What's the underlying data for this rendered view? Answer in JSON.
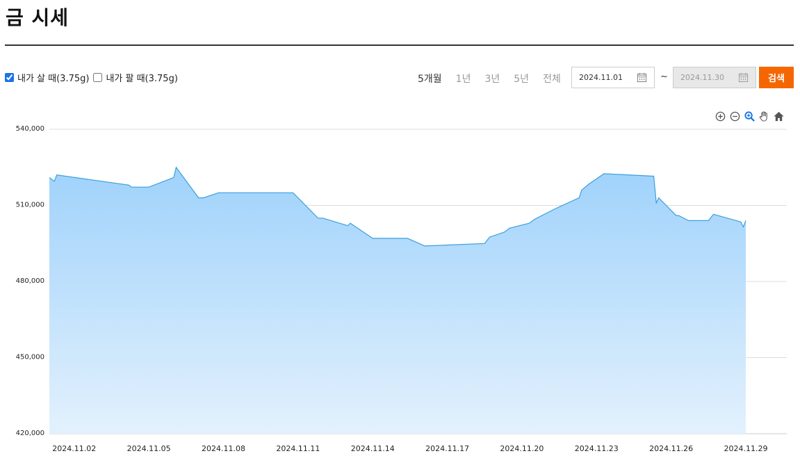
{
  "page": {
    "title": "금 시세"
  },
  "filters": {
    "buy_label": "내가 살 때(3.75g)",
    "buy_checked": true,
    "sell_label": "내가 팔 때(3.75g)",
    "sell_checked": false
  },
  "range_tabs": [
    {
      "label": "5개월",
      "active": true
    },
    {
      "label": "1년",
      "active": false
    },
    {
      "label": "3년",
      "active": false
    },
    {
      "label": "5년",
      "active": false
    },
    {
      "label": "전체",
      "active": false
    }
  ],
  "date_range": {
    "from": "2024.11.01",
    "separator": "~",
    "to": "2024.11.30"
  },
  "search_button_label": "검색",
  "toolbar_icons": [
    "zoom-in-icon",
    "zoom-out-icon",
    "magnifier-zoom-icon",
    "hand-pan-icon",
    "home-reset-icon"
  ],
  "colors": {
    "accent": "#f56600",
    "line": "#3b9fdc",
    "fill_top": "#9fd2fb",
    "fill_bottom": "#e3f1fd",
    "grid": "#dcdcdc"
  },
  "chart_data": {
    "type": "area",
    "title": "",
    "xlabel": "",
    "ylabel": "",
    "ylim": [
      420000,
      540000
    ],
    "y_ticks": [
      420000,
      450000,
      480000,
      510000,
      540000
    ],
    "y_tick_labels": [
      "420,000",
      "450,000",
      "480,000",
      "510,000",
      "540,000"
    ],
    "x_ticks": [
      "2024.11.02",
      "2024.11.05",
      "2024.11.08",
      "2024.11.11",
      "2024.11.14",
      "2024.11.17",
      "2024.11.20",
      "2024.11.23",
      "2024.11.26",
      "2024.11.29"
    ],
    "grid": true,
    "series": [
      {
        "x": [
          1.0,
          1.2,
          1.3,
          4.2,
          4.3,
          5.0,
          6.0,
          6.1,
          7.0,
          7.2,
          7.8,
          10.8,
          11.8,
          12.0,
          13.0,
          13.1,
          14.0,
          15.4,
          16.1,
          18.5,
          18.7,
          19.3,
          19.5,
          20.3,
          20.5,
          21.3,
          22.3,
          22.4,
          22.7,
          23.3,
          25.3,
          25.4,
          25.5,
          26.2,
          26.3,
          26.7,
          27.5,
          27.7,
          28.8,
          28.9,
          29.0
        ],
        "y": [
          521000,
          519500,
          522000,
          518000,
          517200,
          517200,
          521000,
          525000,
          513000,
          513000,
          515000,
          515000,
          505000,
          505000,
          502000,
          503000,
          497000,
          497000,
          494000,
          495000,
          497500,
          499500,
          501000,
          503000,
          504500,
          508500,
          513000,
          516000,
          518500,
          522500,
          521500,
          511000,
          513000,
          506000,
          506000,
          504000,
          504000,
          506500,
          503500,
          501500,
          504000
        ]
      }
    ]
  }
}
